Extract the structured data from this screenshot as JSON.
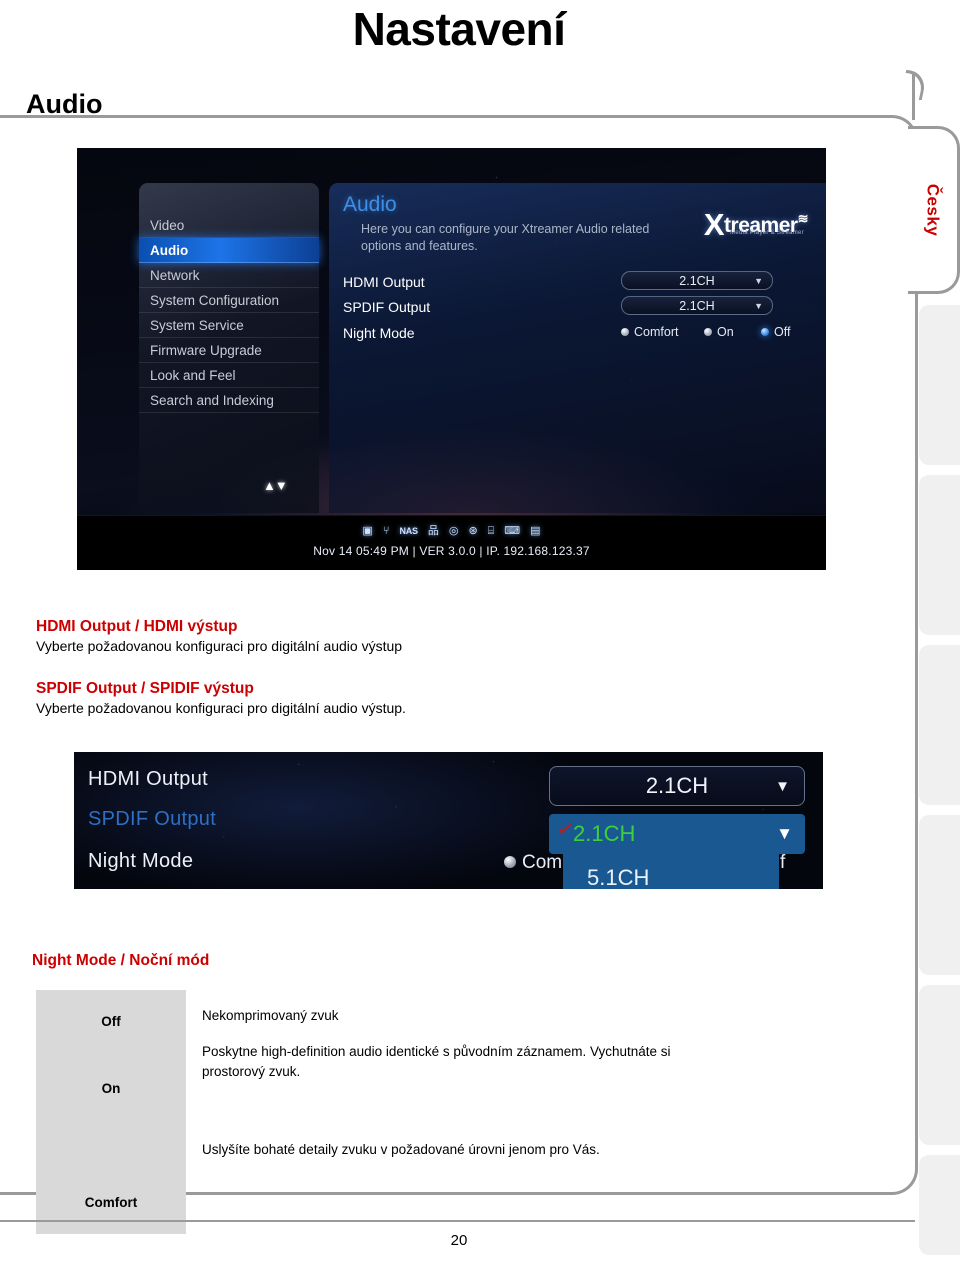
{
  "document": {
    "title": "Nastavení",
    "section": "Audio",
    "page_number": "20",
    "language_tab": "Česky"
  },
  "screenshot_main": {
    "nav": {
      "items": [
        {
          "label": "Video",
          "selected": false
        },
        {
          "label": "Audio",
          "selected": true
        },
        {
          "label": "Network",
          "selected": false
        },
        {
          "label": "System Configuration",
          "selected": false
        },
        {
          "label": "System Service",
          "selected": false
        },
        {
          "label": "Firmware Upgrade",
          "selected": false
        },
        {
          "label": "Look and Feel",
          "selected": false
        },
        {
          "label": "Search and Indexing",
          "selected": false
        }
      ],
      "scroll_indicator": "▲▼"
    },
    "content": {
      "title": "Audio",
      "description": "Here you can configure your Xtreamer Audio related options and features.",
      "brand_x": "X",
      "brand_name": "treamer",
      "brand_wave": "≋",
      "brand_sub": "Media Player & Streamer",
      "rows": [
        {
          "label": "HDMI Output",
          "value": "2.1CH",
          "caret": "▼"
        },
        {
          "label": "SPDIF Output",
          "value": "2.1CH",
          "caret": "▼"
        }
      ],
      "night_mode": {
        "label": "Night Mode",
        "options": [
          {
            "label": "Comfort",
            "selected": false
          },
          {
            "label": "On",
            "selected": false
          },
          {
            "label": "Off",
            "selected": true
          }
        ]
      }
    },
    "statusbar": {
      "icons": [
        "harddisk-icon",
        "usb-icon",
        "nas-icon",
        "network-icon",
        "optical-disc-icon",
        "internet-globe-icon",
        "usb-drive-icon",
        "keyboard-icon",
        "memory-card-icon"
      ],
      "icon_glyphs": [
        "▣",
        "⑂",
        "NAS",
        "品",
        "◎",
        "⊛",
        "⌸",
        "⌨",
        "▤"
      ],
      "text": "Nov 14 05:49 PM | VER 3.0.0 | IP. 192.168.123.37"
    }
  },
  "descriptions": [
    {
      "heading": "HDMI Output / HDMI výstup",
      "body": "Vyberte požadovanou konfiguraci pro digitální audio výstup"
    },
    {
      "heading": "SPDIF Output / SPIDIF výstup",
      "body": "Vyberte požadovanou konfiguraci pro digitální audio výstup."
    }
  ],
  "screenshot_inset": {
    "labels": [
      {
        "text": "HDMI Output",
        "highlighted": false
      },
      {
        "text": "SPDIF Output",
        "highlighted": true
      },
      {
        "text": "Night Mode",
        "highlighted": false
      }
    ],
    "hdmi_select": {
      "value": "2.1CH",
      "caret": "▼"
    },
    "spdif_dropdown": {
      "selected_value": "2.1CH",
      "caret": "▼",
      "check": "✓",
      "options": [
        "2.1CH",
        "5.1CH"
      ],
      "menu_option": "5.1CH"
    },
    "night_mode_partial_left": "Com",
    "night_mode_partial_right": "f"
  },
  "night_mode_table": {
    "title": "Night Mode / Noční mód",
    "rows": [
      {
        "key": "Off",
        "value": "Nekomprimovaný zvuk"
      },
      {
        "key": "On",
        "value": "Poskytne high-definition audio identické s původním záznamem. Vychutnáte si prostorový zvuk."
      },
      {
        "key": "Comfort",
        "value": "Uslyšíte bohaté detaily zvuku v požadované úrovni jenom pro Vás."
      }
    ]
  }
}
